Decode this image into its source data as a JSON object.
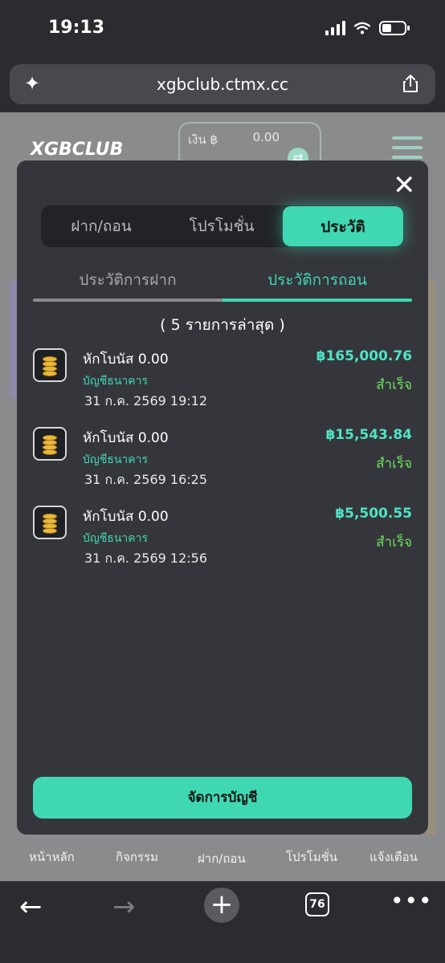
{
  "status_bar": {
    "time": "19:13"
  },
  "browser": {
    "url": "xgbclub.ctmx.cc",
    "tab_count": "76"
  },
  "background": {
    "logo": "XGBCLUB",
    "wallet_label": "เงิน ฿",
    "wallet_value": "0.00",
    "bottom_nav": [
      "หน้าหลัก",
      "กิจกรรม",
      "ฝาก/ถอน",
      "โปรโมชั่น",
      "แจ้งเตือน"
    ]
  },
  "modal": {
    "segments": [
      "ฝาก/ถอน",
      "โปรโมชั่น",
      "ประวัติ"
    ],
    "active_segment": "ประวัติ",
    "subtabs": [
      "ประวัติการฝาก",
      "ประวัติการถอน"
    ],
    "active_subtab": "ประวัติการถอน",
    "count_label": "( 5 รายการล่าสุด )",
    "items": [
      {
        "title": "หักโบนัส 0.00",
        "bank": "บัญชีธนาคาร",
        "date": "31 ก.ค. 2569 19:12",
        "amount": "฿165,000.76",
        "status": "สำเร็จ"
      },
      {
        "title": "หักโบนัส 0.00",
        "bank": "บัญชีธนาคาร",
        "date": "31 ก.ค. 2569 16:25",
        "amount": "฿15,543.84",
        "status": "สำเร็จ"
      },
      {
        "title": "หักโบนัส 0.00",
        "bank": "บัญชีธนาคาร",
        "date": "31 ก.ค. 2569 12:56",
        "amount": "฿5,500.55",
        "status": "สำเร็จ"
      }
    ],
    "manage_label": "จัดการบัญชี"
  },
  "icons": {
    "close": "close-icon",
    "coin": "coins-icon",
    "share": "share-icon",
    "sparkle": "sparkle-icon"
  },
  "colors": {
    "accent": "#3fd8b3",
    "success": "#6de05d",
    "modal_bg": "#35363b"
  }
}
